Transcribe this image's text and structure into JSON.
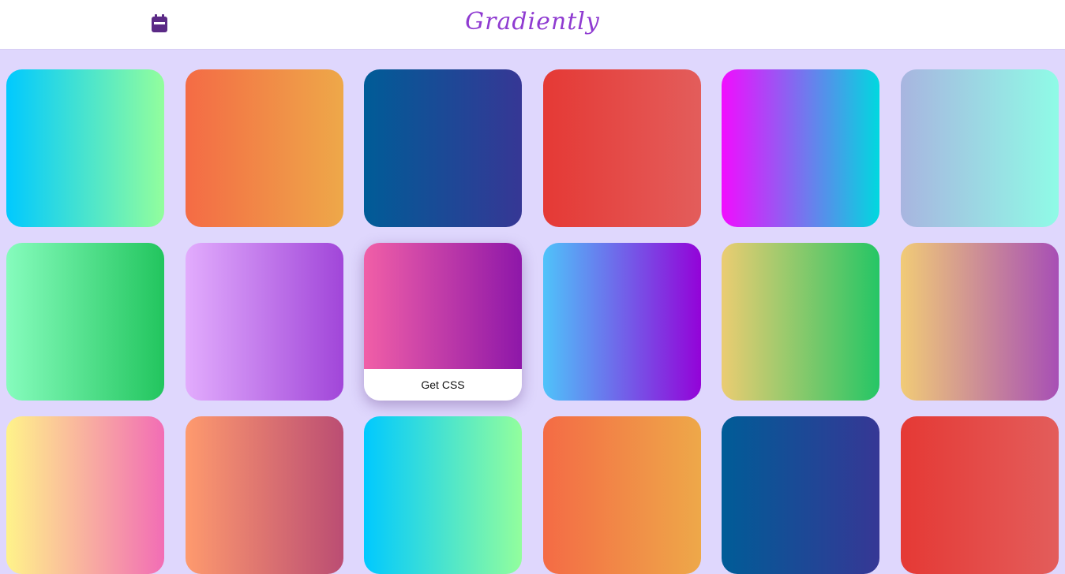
{
  "header": {
    "brand": "Gradiently",
    "brand_color": "#8f3bd1",
    "calendar_icon": "calendar-icon",
    "icon_color": "#5b2a86"
  },
  "grid": {
    "hover_action_label": "Get CSS",
    "gradients": [
      {
        "from": "#00c9ff",
        "to": "#92fe9d"
      },
      {
        "from": "#f46b45",
        "to": "#eea849"
      },
      {
        "from": "#005c97",
        "to": "#363795"
      },
      {
        "from": "#e53935",
        "to": "#e35d5b"
      },
      {
        "from": "#f20cff",
        "to": "#00d8df"
      },
      {
        "from": "#a8b5e0",
        "to": "#8ffbe6"
      },
      {
        "from": "#86fcbd",
        "to": "#22c55e"
      },
      {
        "from": "#e2acfd",
        "to": "#a146d9"
      },
      {
        "from": "#f15fa7",
        "to": "#8e17a9"
      },
      {
        "from": "#4fc3fa",
        "to": "#9303d8"
      },
      {
        "from": "#ebcc72",
        "to": "#25c665"
      },
      {
        "from": "#f1cb77",
        "to": "#a74fb5"
      },
      {
        "from": "#fff38a",
        "to": "#f26db5"
      },
      {
        "from": "#fe9a6e",
        "to": "#bb4d73"
      },
      {
        "from": "#00c9ff",
        "to": "#92fe9d"
      },
      {
        "from": "#f46b45",
        "to": "#eea849"
      },
      {
        "from": "#005c97",
        "to": "#363795"
      },
      {
        "from": "#e53935",
        "to": "#e35d5b"
      }
    ]
  }
}
